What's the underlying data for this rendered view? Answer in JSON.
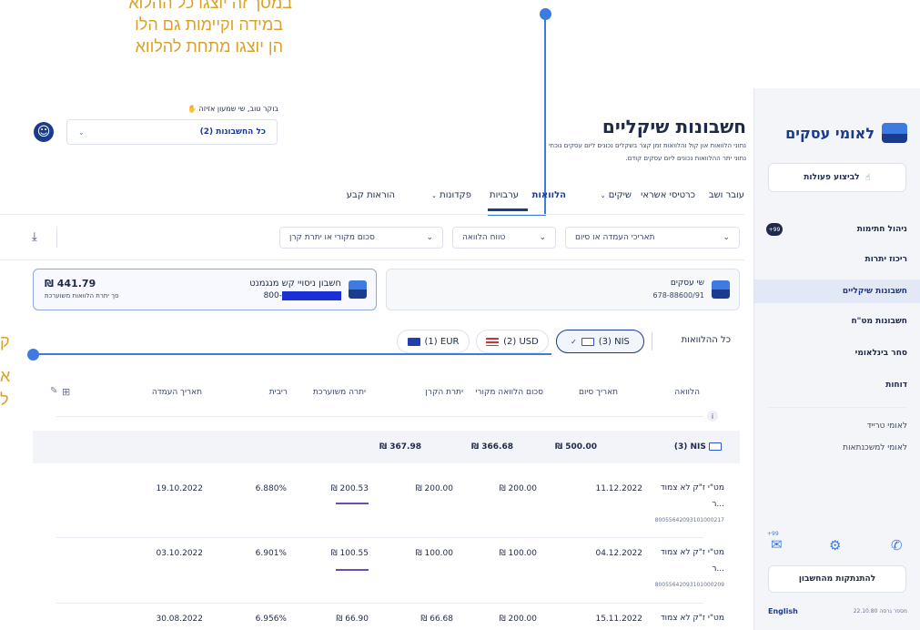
{
  "annotations": {
    "top_lines": [
      "במסך זה יוצגו כל ההלוא",
      "במידה וקיימות גם הלו",
      "הן יוצגו מתחת להלווא"
    ],
    "left_lines": [
      "ק",
      "א",
      "ל"
    ]
  },
  "greeting": "בוקר טוב, שי שמעון אזיזה",
  "account_select": "כל החשבונות (2)",
  "page": {
    "title": "חשבונות שיקליים",
    "subtitle_1": "נתוני הלוואות און קול והלוואות זמן קצר בשקלים נכונים ליום עסקים נוכחי",
    "subtitle_2": "נתוני יתר ההלוואות נכונים ליום עסקים קודם."
  },
  "tabs": [
    "עובר ושב",
    "כרטיסי אשראי",
    "שיקים",
    "הלוואות",
    "ערבויות",
    "פקדונות",
    "הוראות קבע"
  ],
  "filters": [
    "תאריכי העמדה או סיום",
    "טווח הלוואה",
    "סכום מקורי או יתרת קרן"
  ],
  "accounts": {
    "left": {
      "name": "חשבון ניסויי קש מנגמנט",
      "number": "800-",
      "amount": "₪ 441.79",
      "caption": "סך יתרת הלוואות משוערכת"
    },
    "right": {
      "name": "שי עסקים",
      "number": "678-88600/91"
    }
  },
  "currency_filter": {
    "all": "כל ההלוואות",
    "nis": "(3) NIS",
    "usd": "(2) USD",
    "eur": "(1) EUR"
  },
  "table": {
    "headers": [
      "הלוואה",
      "תאריך סיום",
      "סכום הלוואה מקורי",
      "יתרת הקרן",
      "יתרה משוערכת",
      "ריבית",
      "תאריך העמדה"
    ],
    "summary": {
      "label": "(3) NIS",
      "original": "₪ 500.00",
      "principal": "₪ 366.68",
      "estimated": "₪ 367.98"
    },
    "rows": [
      {
        "name": "מט\"י ז\"ק לא צמוד",
        "name2": "...ר",
        "loan_no": "80055642093101000217",
        "end": "11.12.2022",
        "original": "₪ 200.00",
        "principal": "₪ 200.00",
        "estimated": "₪ 200.53",
        "rate": "6.880%",
        "start": "19.10.2022"
      },
      {
        "name": "מט\"י ז\"ק לא צמוד",
        "name2": "...ר",
        "loan_no": "80055642093101000209",
        "end": "04.12.2022",
        "original": "₪ 100.00",
        "principal": "₪ 100.00",
        "estimated": "₪ 100.55",
        "rate": "6.901%",
        "start": "03.10.2022"
      },
      {
        "name": "מט\"י ז\"ק לא צמוד",
        "name2": "",
        "loan_no": "",
        "end": "15.11.2022",
        "original": "₪ 200.00",
        "principal": "₪ 66.68",
        "estimated": "₪ 66.90",
        "rate": "6.956%",
        "start": "30.08.2022"
      }
    ]
  },
  "sidebar": {
    "logo": "לאומי עסקים",
    "action_button": "לביצוע פעולות",
    "items": [
      "ניהול חתימות",
      "ריכוז יתרות",
      "חשבונות שיקליים",
      "חשבונות מט\"ח",
      "סחר בינלאומי",
      "דוחות"
    ],
    "links": [
      "לאומי טרייד",
      "לאומי למשכנתאות"
    ],
    "signature_badge": "+99",
    "mail_badge": "+99",
    "logout": "להתנתקות מהחשבון",
    "english": "English",
    "version": "מספר גרסה 22.10.80"
  },
  "colors": {
    "brand": "#1b3b8f",
    "accent_line": "#3d7be0",
    "annotation_text": "#d9a12a",
    "underline": "#6a4fb0"
  }
}
